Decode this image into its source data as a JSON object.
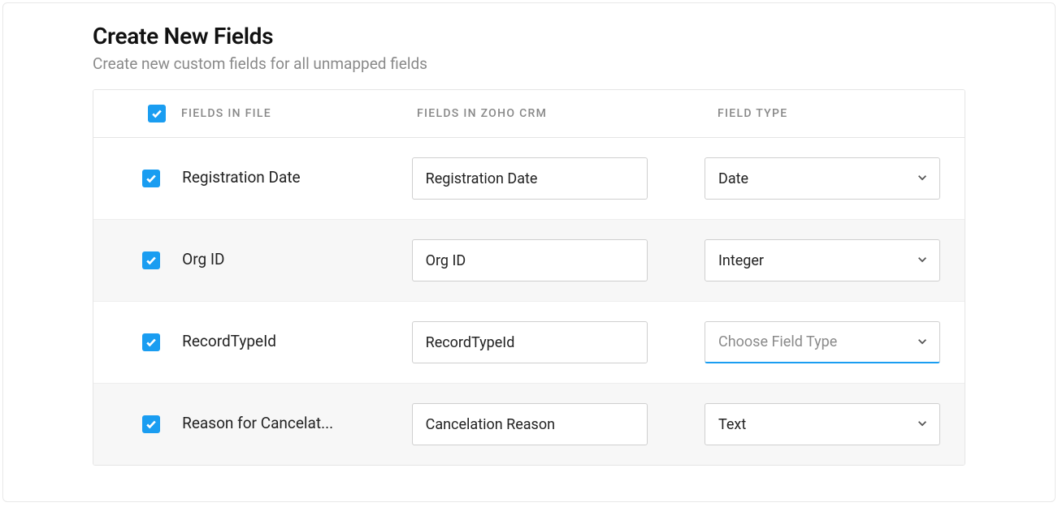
{
  "header": {
    "title": "Create New Fields",
    "subtitle": "Create new custom fields for all unmapped fields"
  },
  "table": {
    "headers": {
      "file": "FIELDS IN FILE",
      "crm": "FIELDS IN ZOHO CRM",
      "type": "FIELD TYPE"
    },
    "select_placeholder": "Choose Field Type",
    "rows": [
      {
        "checked": true,
        "file_label": "Registration Date",
        "crm_value": "Registration Date",
        "type_value": "Date",
        "type_is_placeholder": false,
        "alt": false
      },
      {
        "checked": true,
        "file_label": "Org ID",
        "crm_value": "Org ID",
        "type_value": "Integer",
        "type_is_placeholder": false,
        "alt": true
      },
      {
        "checked": true,
        "file_label": "RecordTypeId",
        "crm_value": "RecordTypeId",
        "type_value": "Choose Field Type",
        "type_is_placeholder": true,
        "alt": false,
        "focused": true
      },
      {
        "checked": true,
        "file_label": "Reason for Cancelat...",
        "crm_value": "Cancelation Reason",
        "type_value": "Text",
        "type_is_placeholder": false,
        "alt": true
      }
    ]
  },
  "colors": {
    "accent": "#1a9df1",
    "text_muted": "#8a8a8a"
  }
}
